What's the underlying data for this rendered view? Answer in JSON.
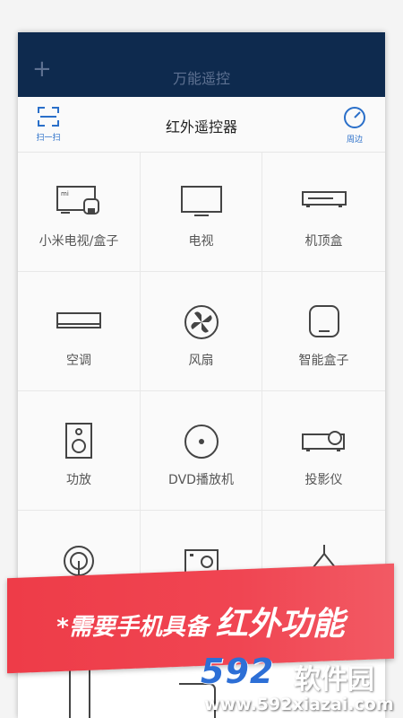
{
  "header": {
    "add_icon": "plus-icon",
    "title": "万能遥控"
  },
  "subheader": {
    "scan_label": "扫一扫",
    "title": "红外遥控器",
    "nearby_label": "周边"
  },
  "devices": [
    {
      "label": "小米电视/盒子",
      "icon": "mi-tv-box-icon"
    },
    {
      "label": "电视",
      "icon": "tv-icon"
    },
    {
      "label": "机顶盒",
      "icon": "set-top-box-icon"
    },
    {
      "label": "空调",
      "icon": "air-conditioner-icon"
    },
    {
      "label": "风扇",
      "icon": "fan-icon"
    },
    {
      "label": "智能盒子",
      "icon": "smart-box-icon"
    },
    {
      "label": "功放",
      "icon": "amplifier-icon"
    },
    {
      "label": "DVD播放机",
      "icon": "dvd-player-icon"
    },
    {
      "label": "投影仪",
      "icon": "projector-icon"
    },
    {
      "label": "",
      "icon": "water-heater-icon"
    },
    {
      "label": "",
      "icon": "camera-icon"
    },
    {
      "label": "",
      "icon": "lamp-icon"
    }
  ],
  "promo": {
    "prefix": "*需要手机具备",
    "emphasis": "红外功能"
  },
  "watermark": {
    "logo": "592",
    "name": "软件园",
    "url": "www.592xiazai.com"
  },
  "colors": {
    "titlebar": "#0e2a4e",
    "accent_blue": "#2a6fc9",
    "promo_red": "#ee3c48"
  }
}
